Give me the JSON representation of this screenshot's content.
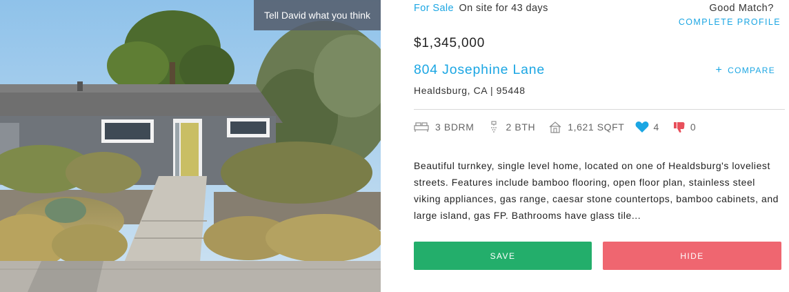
{
  "photo": {
    "feedback_label": "Tell David what you think"
  },
  "listing": {
    "status": "For Sale",
    "days_on_site": "On site for 43 days",
    "match_question": "Good Match?",
    "complete_profile": "COMPLETE PROFILE",
    "price": "$1,345,000",
    "address": "804 Josephine Lane",
    "compare_label": "COMPARE",
    "city_zip": "Healdsburg, CA | 95448"
  },
  "stats": {
    "bedrooms": "3 BDRM",
    "bathrooms": "2 BTH",
    "sqft": "1,621 SQFT",
    "likes": "4",
    "dislikes": "0"
  },
  "description": "Beautiful turnkey, single level home, located on one of Healdsburg's loveliest streets. Features include bamboo flooring, open floor plan, stainless steel viking appliances, gas range, caesar stone countertops, bamboo cabinets, and large island, gas FP. Bathrooms have glass tile...",
  "actions": {
    "save_label": "SAVE",
    "hide_label": "HIDE"
  },
  "colors": {
    "accent_blue": "#1ba6e3",
    "save_green": "#23ae6b",
    "hide_red": "#ef6670",
    "dislike_red": "#e8505b"
  },
  "icons": {
    "bedrooms": "bed-icon",
    "bathrooms": "shower-icon",
    "sqft": "house-icon",
    "likes": "heart-icon",
    "dislikes": "thumbs-down-icon",
    "compare": "plus-icon"
  }
}
